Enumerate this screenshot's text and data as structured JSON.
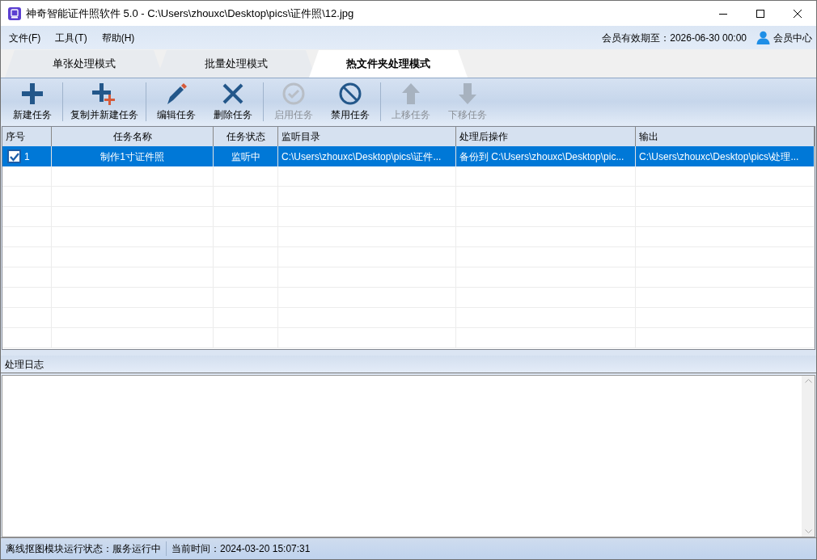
{
  "window": {
    "title": "神奇智能证件照软件 5.0 - C:\\Users\\zhouxc\\Desktop\\pics\\证件照\\12.jpg"
  },
  "menu": [
    "文件(F)",
    "工具(T)",
    "帮助(H)"
  ],
  "membership": {
    "expiry": "会员有效期至：2026-06-30 00:00",
    "center": "会员中心"
  },
  "tabs": [
    {
      "label": "单张处理模式",
      "selected": false
    },
    {
      "label": "批量处理模式",
      "selected": false
    },
    {
      "label": "热文件夹处理模式",
      "selected": true
    }
  ],
  "toolbar": {
    "groups": [
      [
        {
          "label": "新建任务",
          "enabled": true
        }
      ],
      [
        {
          "label": "复制并新建任务",
          "enabled": true
        }
      ],
      [
        {
          "label": "编辑任务",
          "enabled": true
        },
        {
          "label": "删除任务",
          "enabled": true
        }
      ],
      [
        {
          "label": "启用任务",
          "enabled": false
        },
        {
          "label": "禁用任务",
          "enabled": true
        }
      ],
      [
        {
          "label": "上移任务",
          "enabled": false
        },
        {
          "label": "下移任务",
          "enabled": false
        }
      ]
    ]
  },
  "table": {
    "columns": [
      "序号",
      "任务名称",
      "任务状态",
      "监听目录",
      "处理后操作",
      "输出"
    ],
    "rows": [
      {
        "checked": true,
        "selected": true,
        "cells": [
          "1",
          "制作1寸证件照",
          "监听中",
          "C:\\Users\\zhouxc\\Desktop\\pics\\证件...",
          "备份到 C:\\Users\\zhouxc\\Desktop\\pic...",
          "C:\\Users\\zhouxc\\Desktop\\pics\\处理..."
        ]
      }
    ]
  },
  "log": {
    "title": "处理日志"
  },
  "status_bar": [
    "离线抠图模块运行状态：服务运行中",
    "当前时间：2024-03-20 15:07:31"
  ]
}
